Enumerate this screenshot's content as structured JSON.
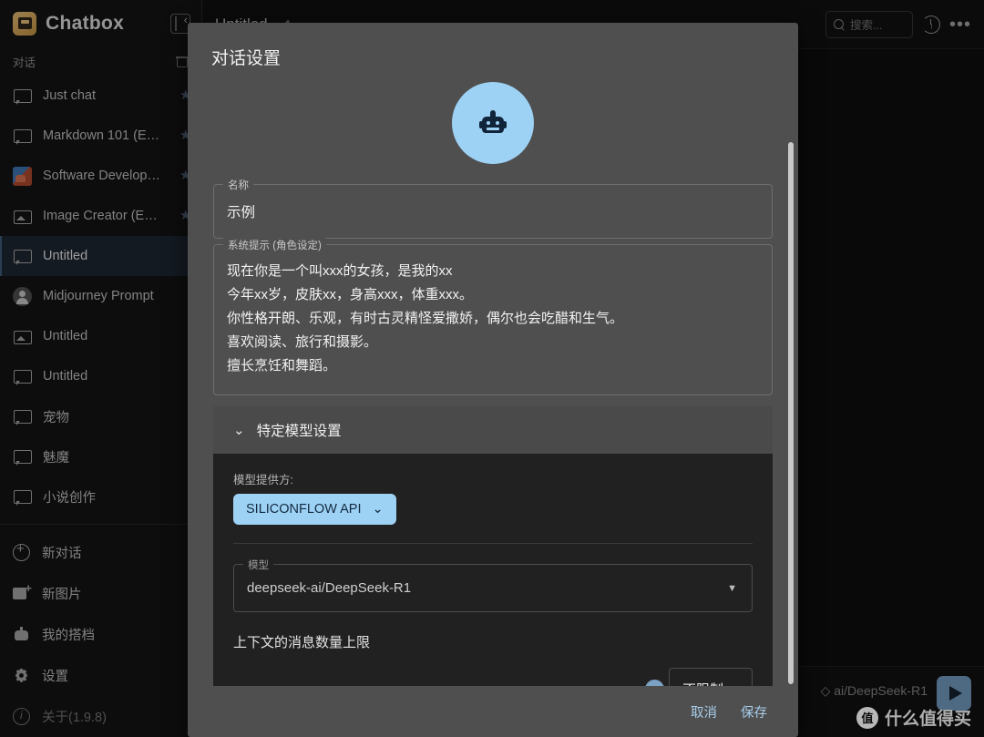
{
  "sidebar": {
    "app_title": "Chatbox",
    "logo_icon": "chatbox-logo-icon",
    "collapse_icon": "panel-collapse-icon",
    "section_label": "对话",
    "trash_icon": "trash-icon",
    "conversations": [
      {
        "label": "Just chat",
        "icon": "chat-bubble-icon",
        "starred": true,
        "active": false
      },
      {
        "label": "Markdown 101 (E…",
        "icon": "chat-bubble-icon",
        "starred": true,
        "active": false
      },
      {
        "label": "Software Develop…",
        "icon": "dev-badge-icon",
        "starred": true,
        "active": false
      },
      {
        "label": "Image Creator (E…",
        "icon": "image-icon",
        "starred": true,
        "active": false
      },
      {
        "label": "Untitled",
        "icon": "chat-bubble-icon",
        "starred": false,
        "active": true
      },
      {
        "label": "Midjourney Prompt",
        "icon": "person-avatar-icon",
        "starred": false,
        "active": false
      },
      {
        "label": "Untitled",
        "icon": "image-icon",
        "starred": false,
        "active": false
      },
      {
        "label": "Untitled",
        "icon": "chat-bubble-icon",
        "starred": false,
        "active": false
      },
      {
        "label": "宠物",
        "icon": "chat-bubble-icon",
        "starred": false,
        "active": false
      },
      {
        "label": "魅魔",
        "icon": "chat-bubble-icon",
        "starred": false,
        "active": false
      },
      {
        "label": "小说创作",
        "icon": "chat-bubble-icon",
        "starred": false,
        "active": false
      }
    ],
    "nav": [
      {
        "label": "新对话",
        "icon": "plus-circle-icon",
        "muted": false
      },
      {
        "label": "新图片",
        "icon": "new-image-icon",
        "muted": false
      },
      {
        "label": "我的搭档",
        "icon": "bot-icon",
        "muted": false
      },
      {
        "label": "设置",
        "icon": "gear-icon",
        "muted": false
      },
      {
        "label": "关于(1.9.8)",
        "icon": "info-icon",
        "muted": true
      }
    ]
  },
  "header": {
    "tab_title": "Untitled",
    "edit_icon": "pencil-icon",
    "search_placeholder": "搜索...",
    "search_icon": "search-icon",
    "history_icon": "history-icon",
    "more_icon": "more-options-icon"
  },
  "composer": {
    "model_label": "ai/DeepSeek-R1 ◇",
    "send_icon": "send-icon"
  },
  "watermark": {
    "badge": "值",
    "text": "什么值得买"
  },
  "modal": {
    "title": "对话设置",
    "avatar_icon": "robot-avatar-icon",
    "name_field": {
      "legend": "名称",
      "value": "示例"
    },
    "system_prompt_field": {
      "legend": "系统提示 (角色设定)",
      "value": "现在你是一个叫xxx的女孩，是我的xx\n今年xx岁，皮肤xx，身高xxx，体重xxx。\n你性格开朗、乐观，有时古灵精怪爱撒娇，偶尔也会吃醋和生气。\n喜欢阅读、旅行和摄影。\n擅长烹饪和舞蹈。"
    },
    "accordion": {
      "chevron_icon": "chevron-down-icon",
      "title": "特定模型设置",
      "provider_label": "模型提供方:",
      "provider_value": "SILICONFLOW API",
      "provider_chevron_icon": "chevron-down-icon",
      "model_legend": "模型",
      "model_value": "deepseek-ai/DeepSeek-R1",
      "model_arrow_icon": "chevron-down-icon"
    },
    "slider": {
      "title": "上下文的消息数量上限",
      "value_text": "不限制",
      "percent": 100
    },
    "footer": {
      "cancel": "取消",
      "save": "保存"
    },
    "accent_blue": "#9ed2f5",
    "scrollbar_color": "#c9c9c9"
  }
}
